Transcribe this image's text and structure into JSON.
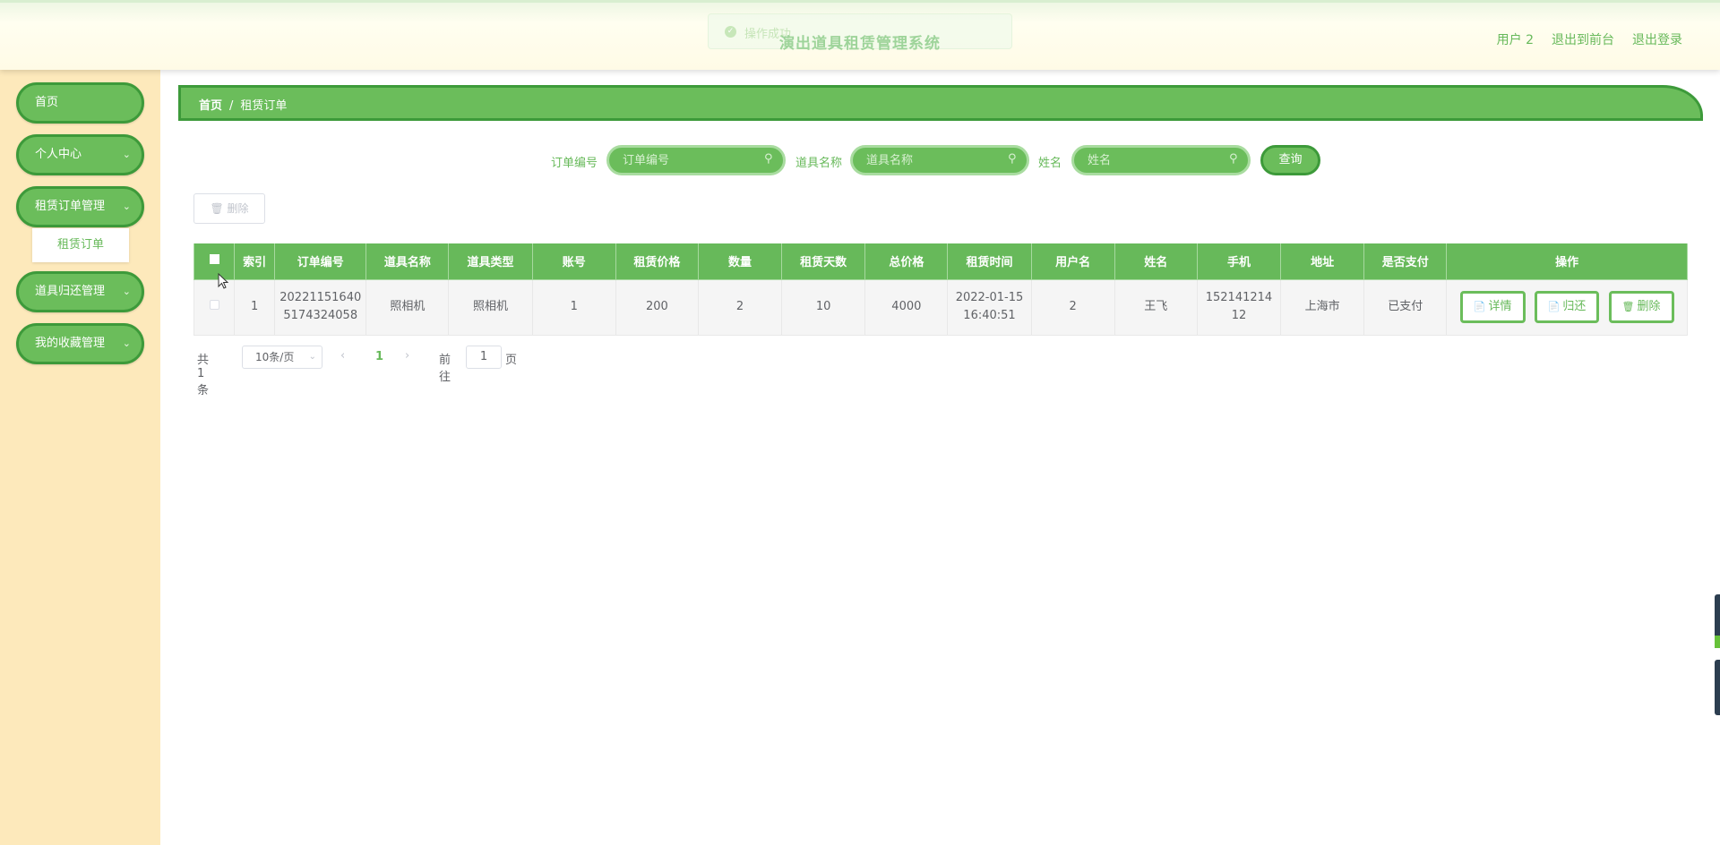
{
  "header": {
    "title": "演出道具租赁管理系统",
    "toast": "操作成功",
    "links": [
      "用户 2",
      "退出到前台",
      "退出登录"
    ]
  },
  "sidebar": {
    "items": [
      {
        "label": "首页"
      },
      {
        "label": "个人中心"
      },
      {
        "label": "租赁订单管理"
      },
      {
        "label": "道具归还管理"
      },
      {
        "label": "我的收藏管理"
      }
    ],
    "submenu": "租赁订单"
  },
  "breadcrumb": {
    "home": "首页",
    "sep": "/",
    "current": "租赁订单"
  },
  "search": {
    "order_label": "订单编号",
    "order_placeholder": "订单编号",
    "prop_label": "道具名称",
    "prop_placeholder": "道具名称",
    "name_label": "姓名",
    "name_placeholder": "姓名",
    "query_button": "查询"
  },
  "toolbar": {
    "delete_label": "删除"
  },
  "table": {
    "headers": [
      "索引",
      "订单编号",
      "道具名称",
      "道具类型",
      "账号",
      "租赁价格",
      "数量",
      "租赁天数",
      "总价格",
      "租赁时间",
      "用户名",
      "姓名",
      "手机",
      "地址",
      "是否支付",
      "操作"
    ],
    "rows": [
      {
        "index": "1",
        "order_no_1": "20221151640",
        "order_no_2": "5174324058",
        "prop_name": "照相机",
        "prop_type": "照相机",
        "account": "1",
        "price": "200",
        "qty": "2",
        "days": "10",
        "total": "4000",
        "time_1": "2022-01-15",
        "time_2": "16:40:51",
        "username": "2",
        "name": "王飞",
        "phone_1": "152141214",
        "phone_2": "12",
        "address": "上海市",
        "paid": "已支付",
        "actions": [
          "详情",
          "归还",
          "删除"
        ]
      }
    ]
  },
  "pagination": {
    "total": "共 1 条",
    "page_size": "10条/页",
    "current_page": "1",
    "goto_prefix": "前往",
    "goto_value": "1",
    "goto_suffix": "页"
  },
  "colors": {
    "primary": "#67b95a",
    "primary_border": "#3d9a3a",
    "sidebar_bg": "#fde9bb"
  }
}
